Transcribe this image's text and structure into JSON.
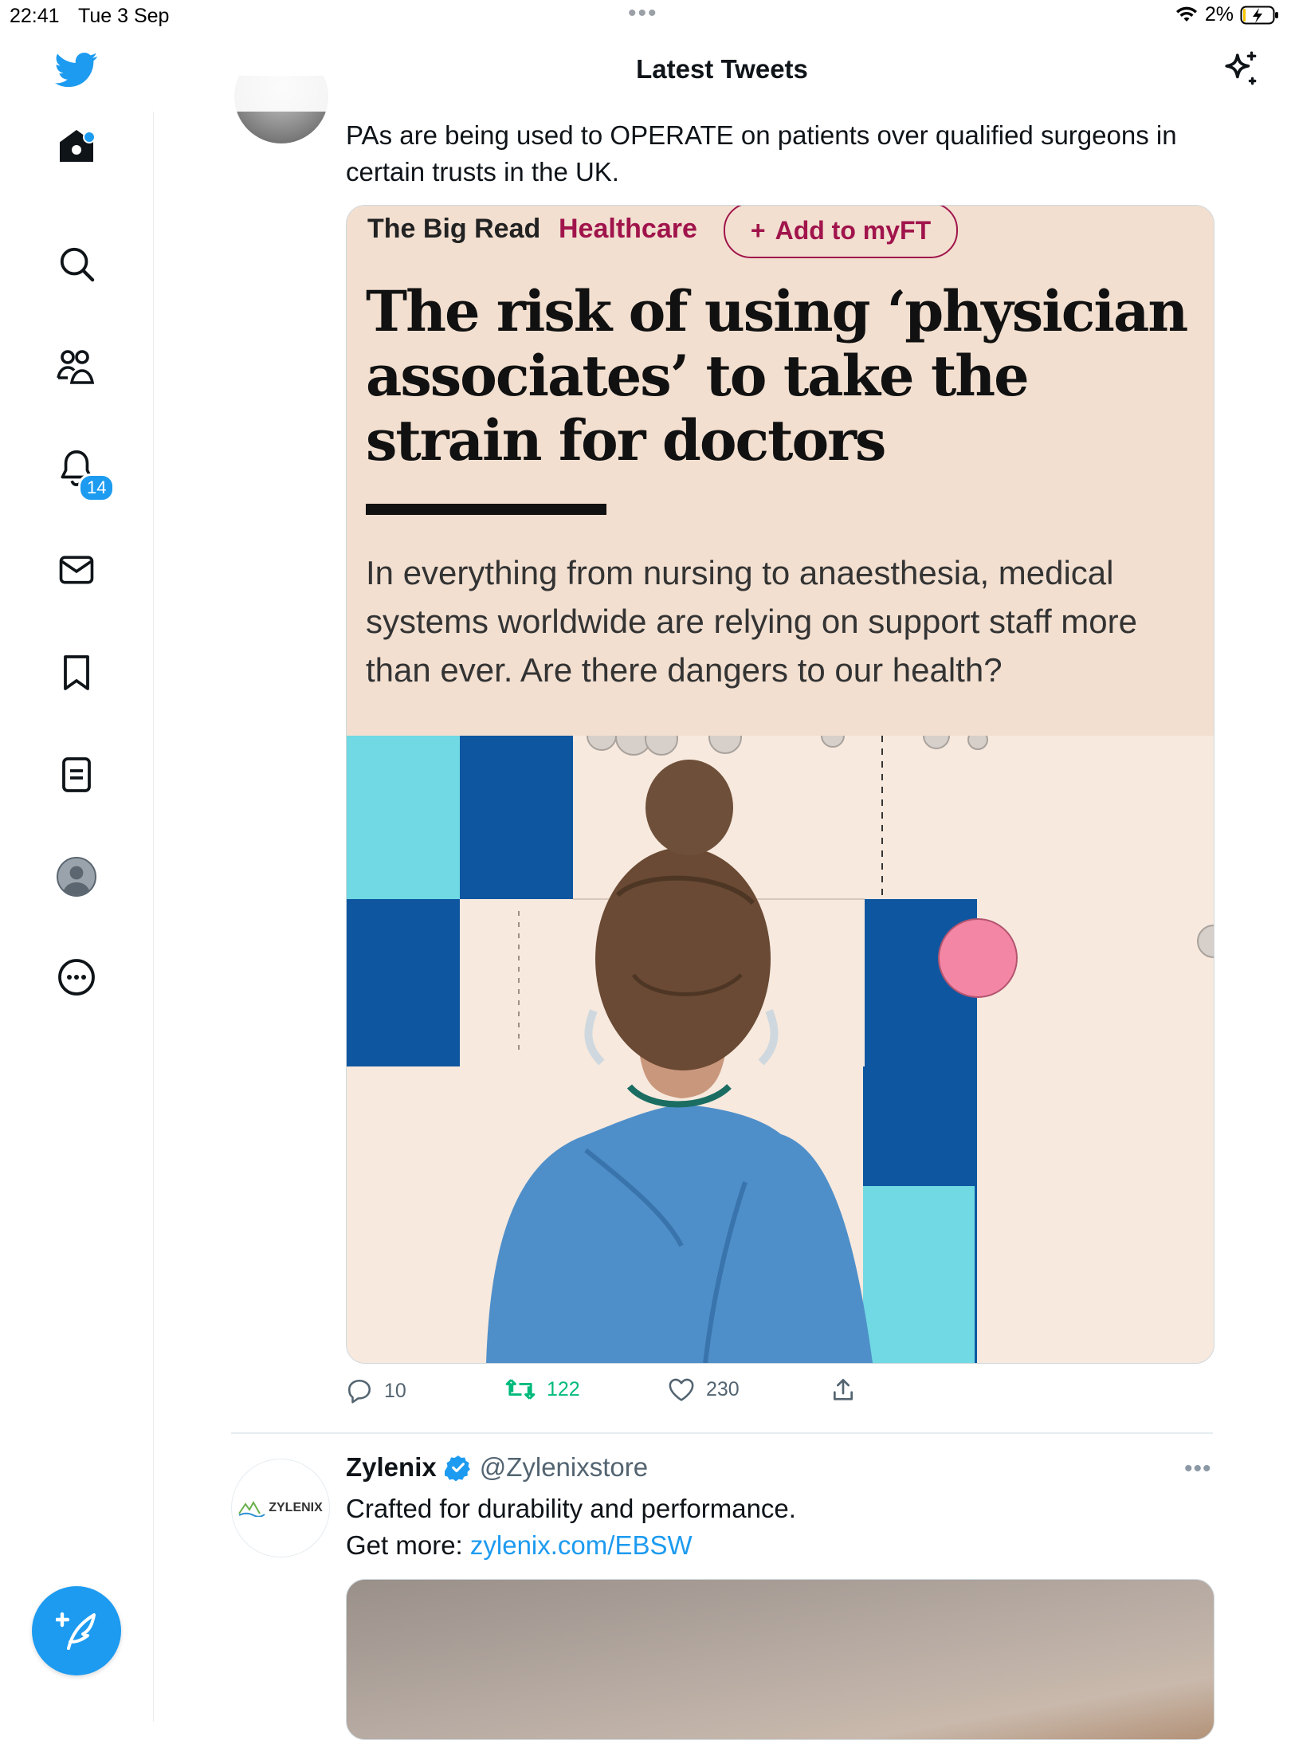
{
  "status_bar": {
    "time": "22:41",
    "date": "Tue 3 Sep",
    "battery": "2%"
  },
  "header": {
    "title": "Latest Tweets"
  },
  "sidebar": {
    "items": [
      {
        "icon": "home-icon"
      },
      {
        "icon": "search-icon"
      },
      {
        "icon": "communities-icon"
      },
      {
        "icon": "notifications-icon",
        "badge": "14"
      },
      {
        "icon": "messages-icon"
      },
      {
        "icon": "bookmarks-icon"
      },
      {
        "icon": "lists-icon"
      },
      {
        "icon": "profile-icon"
      },
      {
        "icon": "more-icon"
      }
    ],
    "compose_icon": "compose-icon"
  },
  "tweet1": {
    "text_line1": "PAs are being used to OPERATE on patients over qualified surgeons in",
    "text_line2": "certain trusts in the UK.",
    "card": {
      "section": "The Big Read",
      "topic": "Healthcare",
      "add_label": "Add to myFT",
      "headline": "The risk of using ‘physician associates’ to take the strain for doctors",
      "standfirst": "In everything from nursing to anaesthesia, medical systems worldwide are relying on support staff more than ever. Are there dangers to our health?"
    },
    "replies": "10",
    "retweets": "122",
    "likes": "230"
  },
  "tweet2": {
    "name": "Zylenix",
    "handle": "@Zylenixstore",
    "avatar_text": "ZYLENIX",
    "text_line1": "Crafted for durability and performance.",
    "text_prefix": "Get more: ",
    "link": "zylenix.com/EBSW"
  },
  "colors": {
    "accent": "#1d9bf0",
    "retweet": "#00ba7c",
    "ft_bg": "#f2dfd0",
    "ft_claret": "#a0144b"
  }
}
